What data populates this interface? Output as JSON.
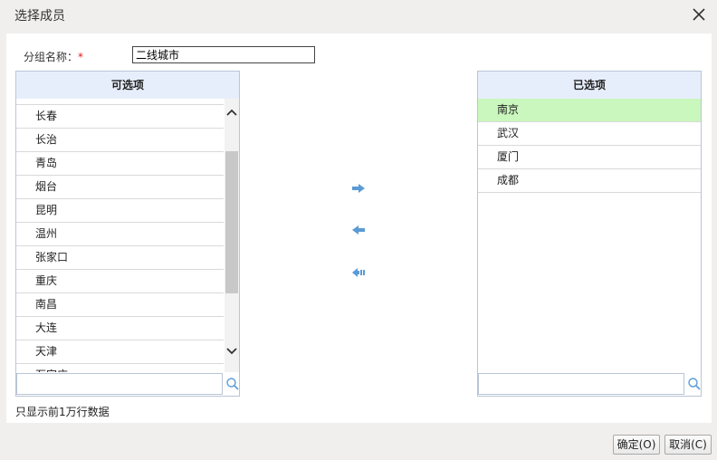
{
  "dialog": {
    "title": "选择成员",
    "close_icon": "close-icon"
  },
  "form": {
    "group_label": "分组名称：",
    "required_mark": "*",
    "group_value": "二线城市"
  },
  "available": {
    "header": "可选项",
    "items": [
      "长春",
      "长治",
      "青岛",
      "烟台",
      "昆明",
      "温州",
      "张家口",
      "重庆",
      "南昌",
      "大连",
      "天津",
      "石家庄"
    ]
  },
  "selected": {
    "header": "已选项",
    "items": [
      "南京",
      "武汉",
      "厦门",
      "成都"
    ],
    "highlighted_index": 0
  },
  "transfer": {
    "add_icon": "arrow-right-icon",
    "remove_icon": "arrow-left-icon",
    "remove_all_icon": "double-arrow-left-icon"
  },
  "footer": {
    "note": "只显示前1万行数据",
    "ok_label": "确定(O)",
    "cancel_label": "取消(C)"
  },
  "colors": {
    "accent_arrow": "#5b9bd5",
    "header_bg": "#e7eefb",
    "selected_bg": "#c9f7bd"
  }
}
